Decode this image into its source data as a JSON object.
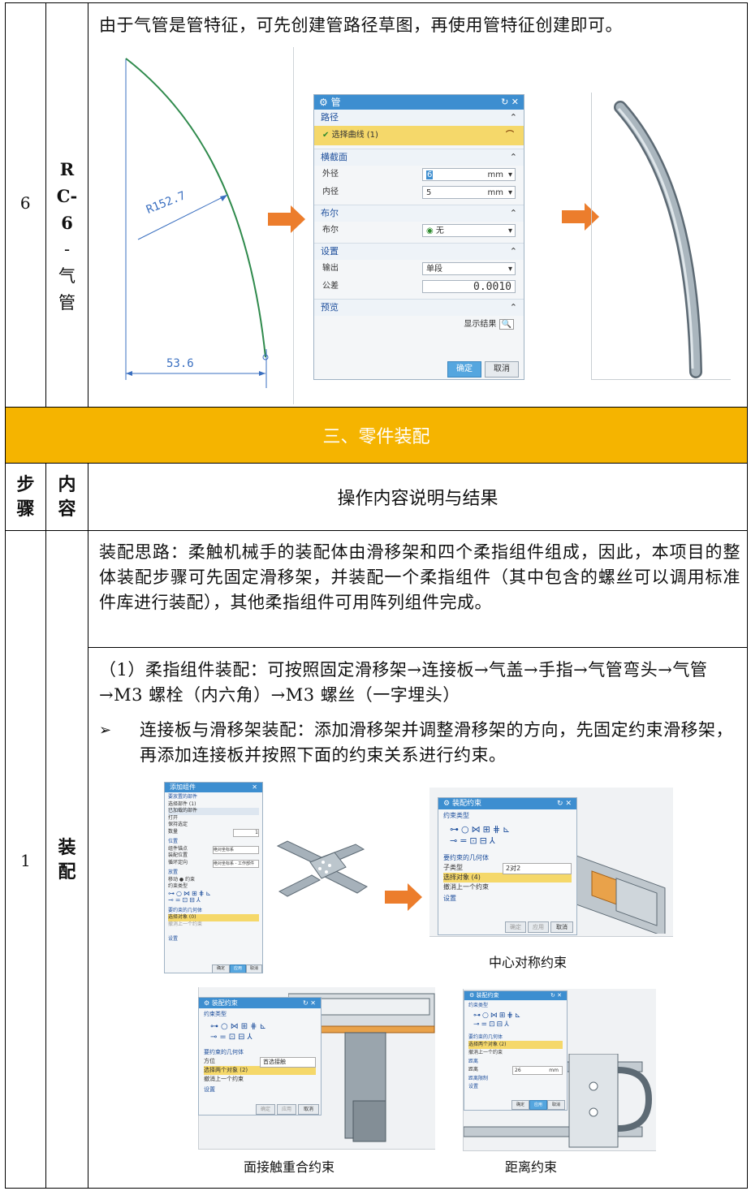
{
  "row6": {
    "step": "6",
    "content_label": [
      "R",
      "C-",
      "6",
      "-",
      "气",
      "管"
    ],
    "description": "由于气管是管特征，可先创建管路径草图，再使用管特征创建即可。",
    "sketch": {
      "radius_label": "R152.7",
      "width_label": "53.6"
    },
    "pipe_dialog": {
      "title": "管",
      "sections": {
        "path": "路径",
        "cross_section": "横截面",
        "boolean": "布尔",
        "settings": "设置",
        "preview": "预览"
      },
      "select_curve": "选择曲线 (1)",
      "outer_label": "外径",
      "outer_value": "6",
      "outer_unit": "mm",
      "inner_label": "内径",
      "inner_value": "5",
      "inner_unit": "mm",
      "boolean_label": "布尔",
      "boolean_value": "无",
      "output_label": "输出",
      "output_value": "单段",
      "tolerance_label": "公差",
      "tolerance_value": "0.0010",
      "show_result": "显示结果",
      "ok": "确定",
      "cancel": "取消"
    }
  },
  "section_header": "三、零件装配",
  "table_header": {
    "step": "步骤",
    "content": "内容",
    "result": "操作内容说明与结果"
  },
  "row1": {
    "step": "1",
    "content": "装配",
    "idea": "装配思路：柔触机械手的装配体由滑移架和四个柔指组件组成，因此，本项目的整体装配步骤可先固定滑移架，并装配一个柔指组件（其中包含的螺丝可以调用标准件库进行装配），其他柔指组件可用阵列组件完成。",
    "step_title": "（1）柔指组件装配：可按照固定滑移架→连接板→气盖→手指→气管弯头→气管→M3 螺栓（内六角）→M3 螺丝（一字埋头）",
    "bullet": "连接板与滑移架装配：添加滑移架并调整滑移架的方向，先固定约束滑移架，再添加连接板并按照下面的约束关系进行约束。",
    "captions": {
      "center": "中心对称约束",
      "face": "面接触重合约束",
      "distance": "距离约束"
    },
    "add_dialog": {
      "title": "添加组件",
      "s1": "要放置的部件",
      "r1": "选择部件 (1)",
      "r2": "已加载的部件",
      "r3": "打开",
      "r4": "保持选定",
      "r5": "数量",
      "r5v": "1",
      "s2": "位置",
      "r6": "组件锚点",
      "r6v": "绝对坐标系",
      "r7": "装配位置",
      "r7v": "绝对坐标系 - 工作部件",
      "r8": "循环定向",
      "s3": "放置",
      "r9": "移动 ● 约束",
      "r10": "约束类型",
      "s4": "要约束的几何体",
      "r11": "选择对象 (0)",
      "r12": "撤消上一个约束",
      "s5": "设置",
      "ok": "确定",
      "apply": "应用",
      "cancel": "取消"
    },
    "center_dialog": {
      "title": "装配约束",
      "s1": "约束类型",
      "s2": "要约束的几何体",
      "r1": "子类型",
      "r1v": "2对2",
      "r2": "选择对象 (4)",
      "r3": "撤消上一个约束",
      "s3": "设置",
      "ok": "确定",
      "apply": "应用",
      "cancel": "取消"
    },
    "face_dialog": {
      "title": "装配约束",
      "s1": "约束类型",
      "s2": "要约束的几何体",
      "r1": "方位",
      "r1v": "首选接触",
      "r2": "选择两个对象 (2)",
      "r3": "撤消上一个约束",
      "s3": "设置",
      "ok": "确定",
      "apply": "应用",
      "cancel": "取消"
    },
    "dist_dialog": {
      "title": "装配约束",
      "s1": "约束类型",
      "s2": "要约束的几何体",
      "r1": "选择两个对象 (2)",
      "r2": "撤消上一个约束",
      "s3": "距离",
      "r3": "距离",
      "r3v": "26",
      "r3u": "mm",
      "s4": "距离限制",
      "s5": "设置",
      "ok": "确定",
      "apply": "应用",
      "cancel": "取消"
    }
  }
}
